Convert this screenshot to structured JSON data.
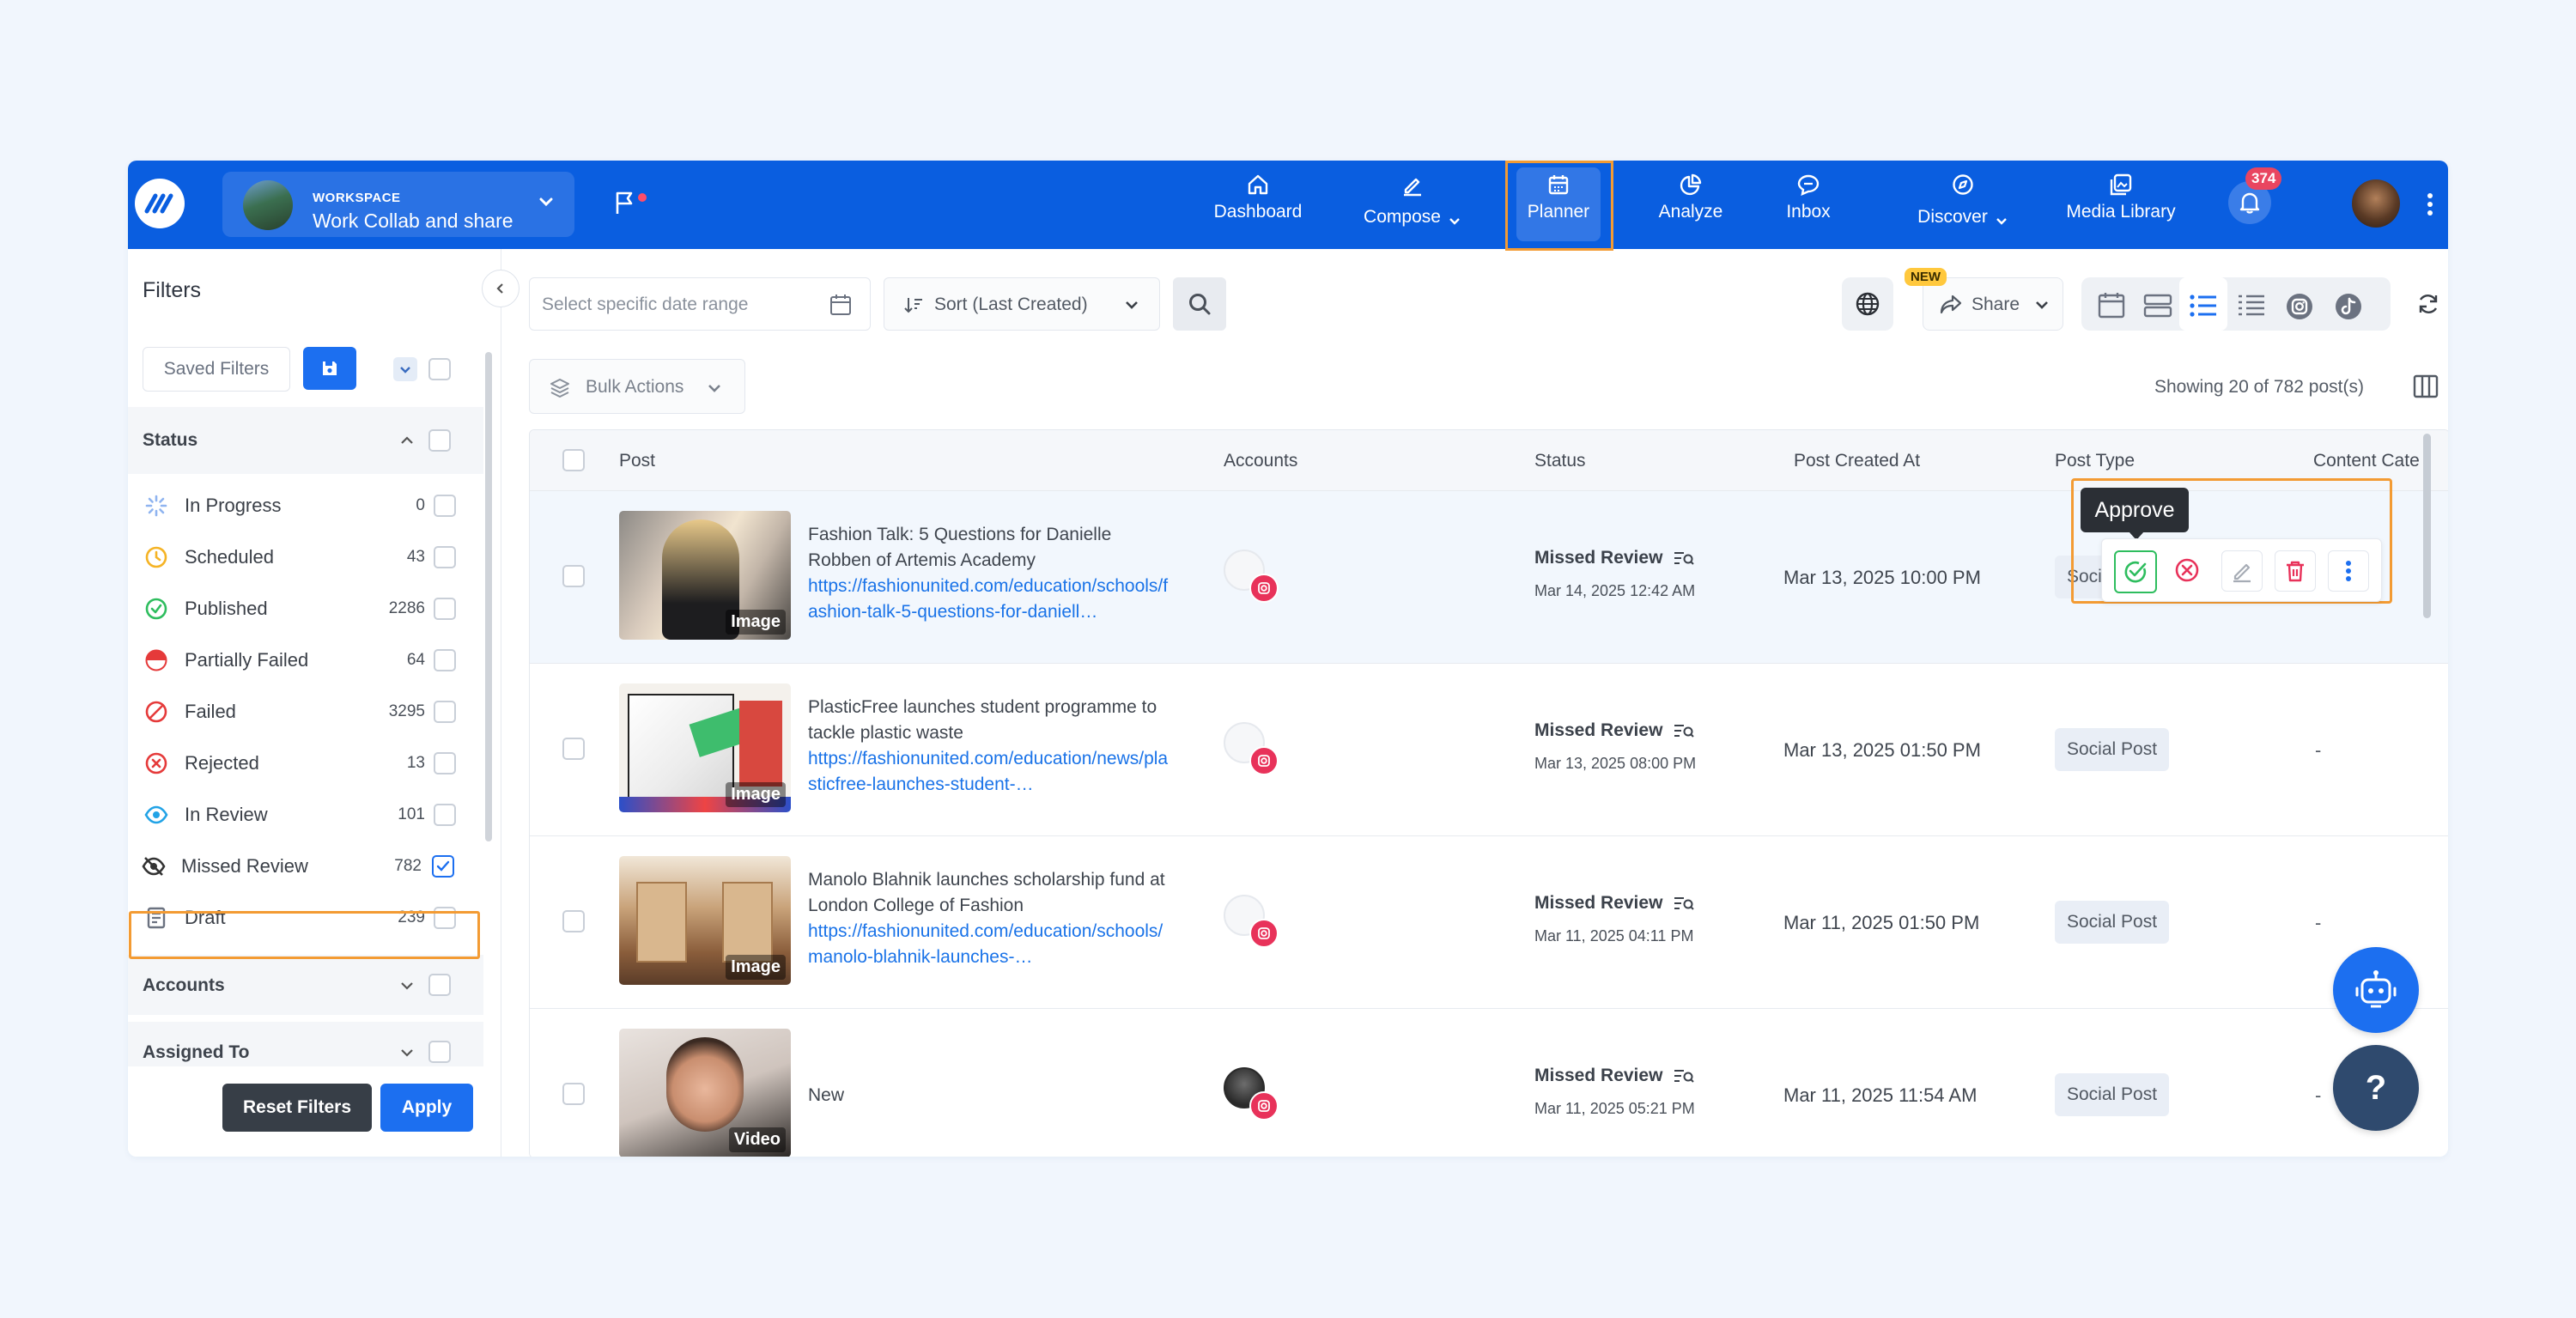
{
  "workspace": {
    "caption": "WORKSPACE",
    "name": "Work Collab and share"
  },
  "nav": {
    "items": [
      {
        "label": "Dashboard",
        "icon": "home-icon"
      },
      {
        "label": "Compose",
        "icon": "pen-icon",
        "has_dropdown": true
      },
      {
        "label": "Planner",
        "icon": "calendar-icon",
        "active": true
      },
      {
        "label": "Analyze",
        "icon": "pie-chart-icon"
      },
      {
        "label": "Inbox",
        "icon": "chat-icon"
      },
      {
        "label": "Discover",
        "icon": "compass-icon",
        "has_dropdown": true
      },
      {
        "label": "Media Library",
        "icon": "media-icon"
      }
    ],
    "notifications": "374"
  },
  "sidebar": {
    "title": "Filters",
    "saved_filters": "Saved Filters",
    "status_header": "Status",
    "statuses": [
      {
        "label": "In Progress",
        "count": "0",
        "icon": "spinner-icon",
        "color": "#8fb4f0"
      },
      {
        "label": "Scheduled",
        "count": "43",
        "icon": "clock-icon",
        "color": "#f5b324"
      },
      {
        "label": "Published",
        "count": "2286",
        "icon": "check-circle-icon",
        "color": "#2ebd5e"
      },
      {
        "label": "Partially Failed",
        "count": "64",
        "icon": "half-circle-icon",
        "color": "#e53a3a"
      },
      {
        "label": "Failed",
        "count": "3295",
        "icon": "ban-icon",
        "color": "#e53a3a"
      },
      {
        "label": "Rejected",
        "count": "13",
        "icon": "x-circle-icon",
        "color": "#e53a3a"
      },
      {
        "label": "In Review",
        "count": "101",
        "icon": "eye-icon",
        "color": "#22a3e6"
      },
      {
        "label": "Missed Review",
        "count": "782",
        "icon": "eye-off-icon",
        "color": "#333333",
        "checked": true
      },
      {
        "label": "Draft",
        "count": "239",
        "icon": "document-icon",
        "color": "#6b7280"
      }
    ],
    "accounts_header": "Accounts",
    "assigned_header": "Assigned To",
    "reset_label": "Reset Filters",
    "apply_label": "Apply"
  },
  "toolbar": {
    "date_placeholder": "Select specific date range",
    "sort_label": "Sort (Last Created)",
    "share_label": "Share",
    "new_badge": "NEW",
    "bulk_actions": "Bulk Actions",
    "showing": "Showing 20 of 782 post(s)"
  },
  "table": {
    "headers": [
      "Post",
      "Accounts",
      "Status",
      "Post Created At",
      "Post Type",
      "Content Cate"
    ],
    "rows": [
      {
        "title": "Fashion Talk: 5 Questions for Danielle Robben of Artemis Academy",
        "link": "https://fashionunited.com/education/schools/fashion-talk-5-questions-for-daniell…",
        "media": "Image",
        "status": "Missed Review",
        "status_date": "Mar 14, 2025 12:42 AM",
        "created": "Mar 13, 2025 10:00 PM",
        "type": "Socia",
        "category": ""
      },
      {
        "title": "PlasticFree launches student programme to tackle plastic waste",
        "link": "https://fashionunited.com/education/news/plasticfree-launches-student-…",
        "media": "Image",
        "status": "Missed Review",
        "status_date": "Mar 13, 2025 08:00 PM",
        "created": "Mar 13, 2025 01:50 PM",
        "type": "Social Post",
        "category": "-"
      },
      {
        "title": "Manolo Blahnik launches scholarship fund at London College of Fashion",
        "link": "https://fashionunited.com/education/schools/manolo-blahnik-launches-…",
        "media": "Image",
        "status": "Missed Review",
        "status_date": "Mar 11, 2025 04:11 PM",
        "created": "Mar 11, 2025 01:50 PM",
        "type": "Social Post",
        "category": "-"
      },
      {
        "title": "New",
        "link": "",
        "media": "Video",
        "status": "Missed Review",
        "status_date": "Mar 11, 2025 05:21 PM",
        "created": "Mar 11, 2025 11:54 AM",
        "type": "Social Post",
        "category": "-"
      }
    ]
  },
  "row_actions": {
    "tooltip": "Approve"
  },
  "fab": {
    "help": "?"
  },
  "colors": {
    "brand": "#0a5ee0",
    "accent": "#1c6ff0",
    "highlight": "#f39b33"
  }
}
